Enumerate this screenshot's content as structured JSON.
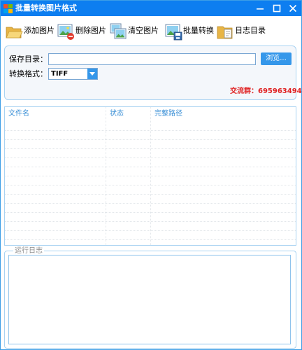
{
  "window": {
    "title": "批量转换图片格式",
    "minimize_icon": "minimize-icon",
    "maximize_icon": "maximize-icon",
    "close_icon": "close-icon"
  },
  "toolbar": {
    "add_images": "添加图片",
    "delete_images": "删除图片",
    "clear_images": "清空图片",
    "batch_convert": "批量转换",
    "log_directory": "日志目录"
  },
  "settings": {
    "save_dir_label": "保存目录：",
    "save_dir_value": "",
    "browse_label": "浏览...",
    "format_label": "转换格式：",
    "format_value": "TIFF",
    "group_info": "交流群：695963494"
  },
  "table": {
    "columns": [
      "文件名",
      "状态",
      "完整路径"
    ],
    "rows": []
  },
  "log": {
    "legend": "运行日志",
    "content": ""
  },
  "colors": {
    "titlebar": "#0d7ef0",
    "accent": "#3597ea",
    "group_info": "#e02020"
  }
}
